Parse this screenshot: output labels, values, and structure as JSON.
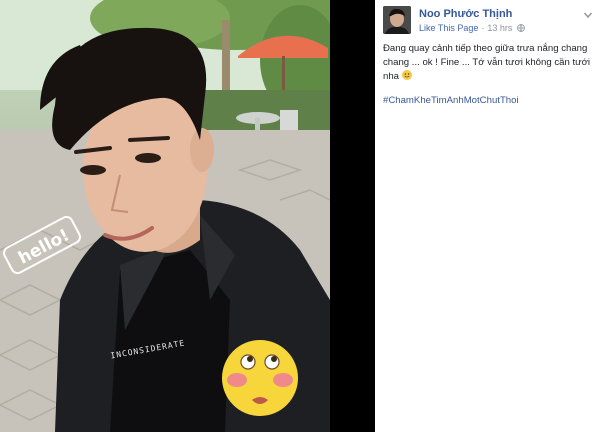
{
  "post": {
    "author": "Noo Phước Thịnh",
    "like_page": "Like This Page",
    "separator": "·",
    "time": "13 hrs",
    "text": "Đang quay cảnh tiếp theo giữa trưa nắng chang chang ... ok ! Fine ... Tớ vẫn tươi không cần tưới nha",
    "hashtag": "#ChamKheTimAnhMotChutThoi"
  },
  "photo": {
    "sticker_text": "hello!",
    "shirt_text": "INCONSIDERATE"
  },
  "colors": {
    "link": "#365899",
    "meta": "#90949c",
    "text": "#1d2129",
    "photo_background": "#000000"
  },
  "icons": [
    "globe-icon",
    "chevron-down-icon",
    "smile-emoji-icon",
    "blushing-emoji-sticker"
  ]
}
